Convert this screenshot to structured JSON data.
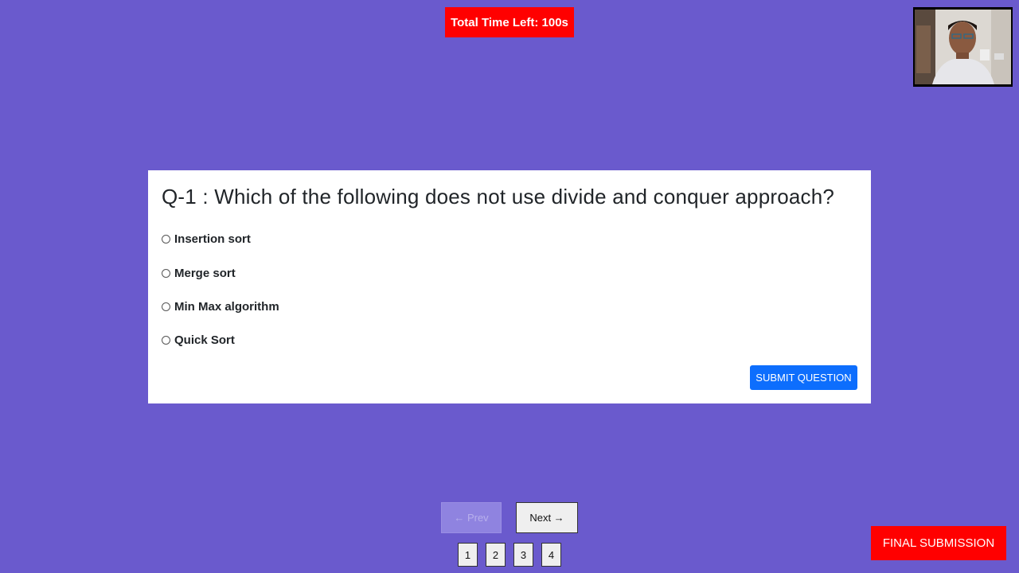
{
  "timer": {
    "text": "Total Time Left: 100s"
  },
  "webcam": {
    "label": "webcam-feed"
  },
  "question": {
    "text": "Q-1 : Which of the following does not use divide and conquer approach?",
    "options": [
      {
        "label": "Insertion sort",
        "selected": false
      },
      {
        "label": "Merge sort",
        "selected": false
      },
      {
        "label": "Min Max algorithm",
        "selected": false
      },
      {
        "label": "Quick Sort",
        "selected": false
      }
    ],
    "submit_label": "SUBMIT QUESTION"
  },
  "navigation": {
    "prev_label": "← Prev",
    "next_label": "Next →",
    "pages": [
      "1",
      "2",
      "3",
      "4"
    ]
  },
  "final_submission_label": "FINAL SUBMISSION",
  "colors": {
    "background": "#6a5acd",
    "timer_bg": "#ff0000",
    "submit_bg": "#0d6efd",
    "final_bg": "#ff0000"
  }
}
